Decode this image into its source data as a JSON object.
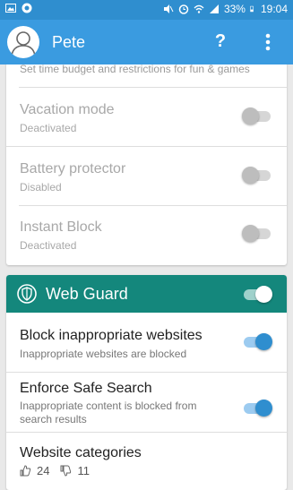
{
  "status_bar": {
    "battery": "33%",
    "time": "19:04"
  },
  "app_bar": {
    "title": "Pete",
    "help_label": "?"
  },
  "card_top": {
    "partial_text": "Set time budget and restrictions for fun & games",
    "rows": [
      {
        "title": "Vacation mode",
        "subtitle": "Deactivated",
        "enabled": false
      },
      {
        "title": "Battery protector",
        "subtitle": "Disabled",
        "enabled": false
      },
      {
        "title": "Instant Block",
        "subtitle": "Deactivated",
        "enabled": false
      }
    ]
  },
  "web_guard": {
    "title": "Web Guard",
    "enabled": true,
    "rows": [
      {
        "title": "Block inappropriate websites",
        "subtitle": "Inappropriate websites are blocked",
        "enabled": true
      },
      {
        "title": "Enforce Safe Search",
        "subtitle": "Inappropriate content is blocked from search results",
        "enabled": true
      }
    ],
    "categories": {
      "title": "Website categories",
      "allowed_count": "24",
      "blocked_count": "11"
    }
  },
  "colors": {
    "status_bar": "#2f8ecf",
    "app_bar": "#3a9be0",
    "web_guard_header": "#14877c",
    "switch_on": "#2f8ecf"
  },
  "icons": [
    "image-icon",
    "app-icon",
    "mute-icon",
    "alarm-icon",
    "wifi-icon",
    "signal-icon",
    "battery-icon",
    "avatar-icon",
    "help-icon",
    "more-vert-icon",
    "shield-icon",
    "thumbs-up-icon",
    "thumbs-down-icon"
  ]
}
